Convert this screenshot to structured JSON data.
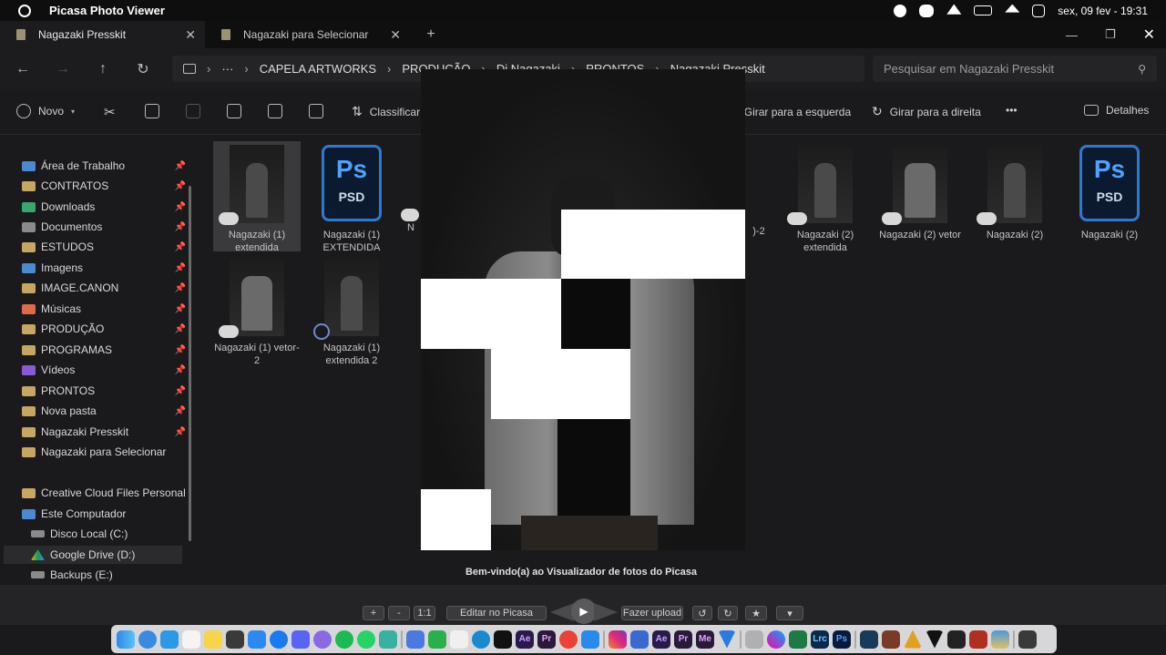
{
  "menubar": {
    "app_name": "Picasa Photo Viewer",
    "clock": "sex, 09 fev - 19:31"
  },
  "tabs": [
    {
      "label": "Nagazaki Presskit",
      "close": "✕"
    },
    {
      "label": "Nagazaki para Selecionar",
      "close": "✕"
    }
  ],
  "new_tab": "+",
  "window_controls": {
    "minimize": "—",
    "maximize": "❐",
    "close": "✕"
  },
  "nav": {
    "back": "←",
    "forward": "→",
    "up": "↑",
    "refresh": "↻"
  },
  "breadcrumb": {
    "more": "···",
    "items": [
      "CAPELA ARTWORKS",
      "PRODUÇÃO",
      "Dj Nagazaki",
      "PRONTOS",
      "Nagazaki Presskit"
    ],
    "separator": "›"
  },
  "search": {
    "placeholder": "Pesquisar em Nagazaki Presskit",
    "icon": "search-icon"
  },
  "commands": {
    "new": "Novo",
    "sort": "Classificar",
    "rotate_left": "Girar para a esquerda",
    "rotate_right": "Girar para a direita",
    "more": "•••",
    "details": "Detalhes"
  },
  "sidebar": {
    "items": [
      {
        "label": "Área de Trabalho",
        "pinned": true
      },
      {
        "label": "CONTRATOS",
        "pinned": true
      },
      {
        "label": "Downloads",
        "pinned": true
      },
      {
        "label": "Documentos",
        "pinned": true
      },
      {
        "label": "ESTUDOS",
        "pinned": true
      },
      {
        "label": "Imagens",
        "pinned": true
      },
      {
        "label": "IMAGE.CANON",
        "pinned": true
      },
      {
        "label": "Músicas",
        "pinned": true
      },
      {
        "label": "PRODUÇÃO",
        "pinned": true
      },
      {
        "label": "PROGRAMAS",
        "pinned": true
      },
      {
        "label": "Vídeos",
        "pinned": true
      },
      {
        "label": "PRONTOS",
        "pinned": true
      },
      {
        "label": "Nova pasta",
        "pinned": true
      },
      {
        "label": "Nagazaki Presskit",
        "pinned": true
      },
      {
        "label": "Nagazaki para Selecionar",
        "pinned": false
      }
    ],
    "drives": [
      {
        "label": "Creative Cloud Files Personal Ac"
      },
      {
        "label": "Este Computador"
      },
      {
        "label": "Disco Local (C:)"
      },
      {
        "label": "Google Drive (D:)"
      },
      {
        "label": "Backups (E:)"
      }
    ],
    "pin_glyph": "📌"
  },
  "files": [
    {
      "name": "Nagazaki (1) extendida",
      "type": "photo"
    },
    {
      "name": "Nagazaki (1) EXTENDIDA",
      "type": "psd"
    },
    {
      "name": "N",
      "type": "psd-partial"
    },
    {
      "name": ")-2",
      "type": "partial"
    },
    {
      "name": "Nagazaki (2) extendida",
      "type": "photo"
    },
    {
      "name": "Nagazaki (2) vetor",
      "type": "photo"
    },
    {
      "name": "Nagazaki (2)",
      "type": "photo"
    },
    {
      "name": "Nagazaki (2)",
      "type": "psd"
    },
    {
      "name": "Nagazaki (1) vetor-2",
      "type": "photo"
    },
    {
      "name": "Nagazaki (1) extendida 2",
      "type": "photo"
    }
  ],
  "psd_label": {
    "big": "Ps",
    "small": "PSD"
  },
  "viewer": {
    "welcome": "Bem-vindo(a) ao Visualizador de fotos do Picasa"
  },
  "picasa_toolbar": {
    "zoom_in": "+",
    "zoom_out": "-",
    "actual_size": "1:1",
    "edit": "Editar no Picasa",
    "upload": "Fazer upload",
    "rotate_ccw": "↺",
    "rotate_cw": "↻",
    "star": "★",
    "more": "▾",
    "play": "▶"
  },
  "dock_icons": [
    "finder",
    "safari",
    "cloud",
    "notes",
    "stickies",
    "calculator",
    "appstore",
    "messenger",
    "discord",
    "messages",
    "spotify",
    "whatsapp",
    "chatgpt",
    "files",
    "numbers",
    "notes-yellow",
    "edge",
    "capcut",
    "after-effects",
    "premiere",
    "chrome",
    "finder-2",
    "instagram",
    "xcode",
    "after-effects-2",
    "premiere-2",
    "media-encoder",
    "vpn",
    "system",
    "photos",
    "excel",
    "lightroom",
    "photoshop",
    "steam",
    "game",
    "games-2",
    "marker",
    "black",
    "red",
    "preview",
    "trash"
  ]
}
